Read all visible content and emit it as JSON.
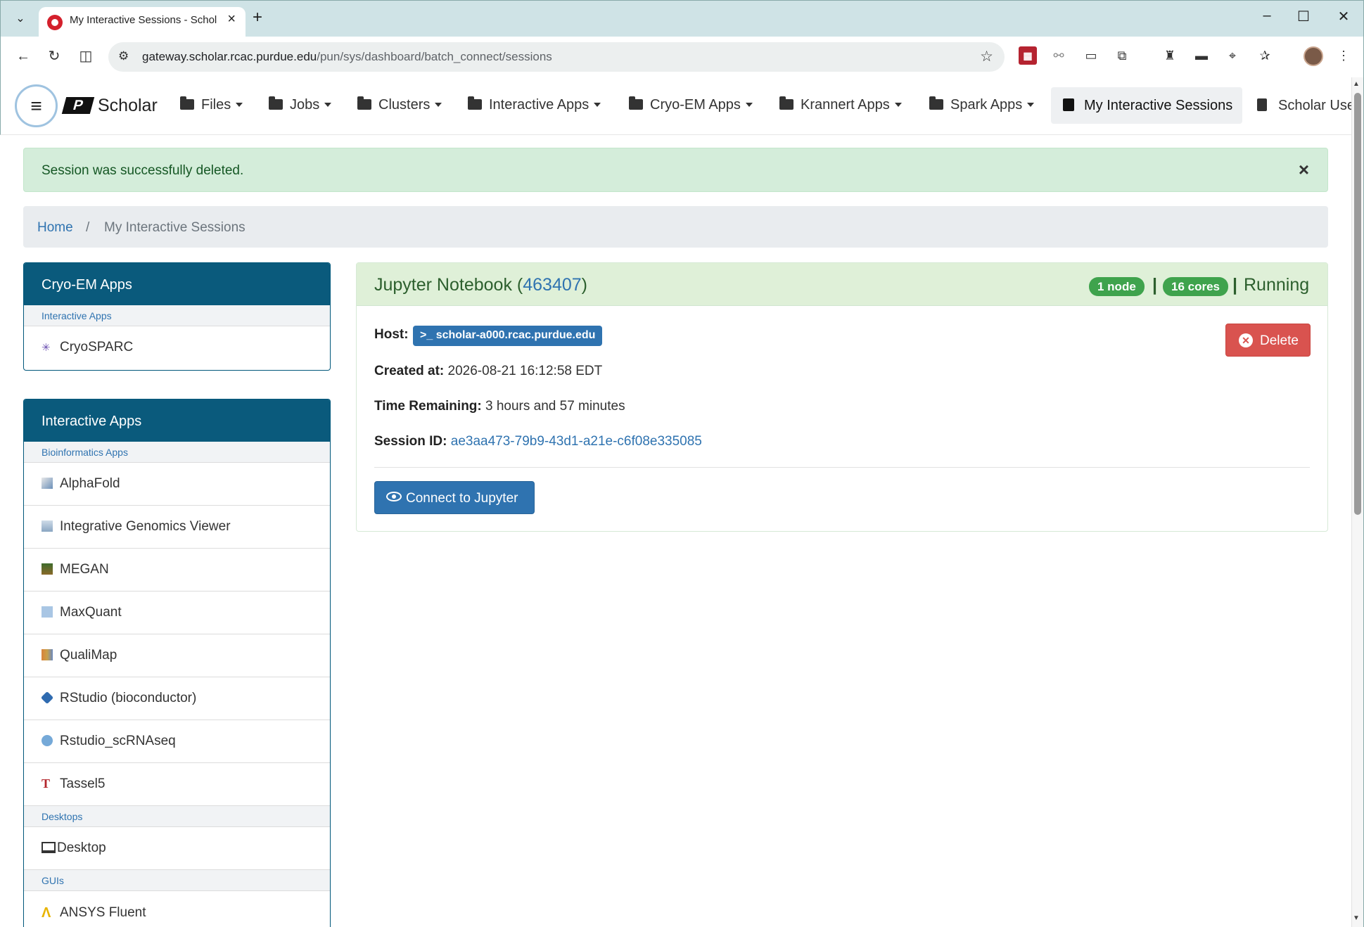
{
  "browser": {
    "tab_title": "My Interactive Sessions - Scholar",
    "url_host": "gateway.scholar.rcac.purdue.edu",
    "url_path": "/pun/sys/dashboard/batch_connect/sessions"
  },
  "navbar": {
    "brand": "Scholar",
    "items": [
      {
        "label": "Files"
      },
      {
        "label": "Jobs"
      },
      {
        "label": "Clusters"
      },
      {
        "label": "Interactive Apps"
      },
      {
        "label": "Cryo-EM Apps"
      },
      {
        "label": "Krannert Apps"
      },
      {
        "label": "Spark Apps"
      }
    ],
    "active": "My Interactive Sessions",
    "guide": "Scholar Use"
  },
  "alert": {
    "message": "Session was successfully deleted.",
    "close": "×"
  },
  "breadcrumb": {
    "home": "Home",
    "sep": "/",
    "current": "My Interactive Sessions"
  },
  "sidebar": {
    "cryo_panel": {
      "title": "Cryo-EM Apps",
      "section": "Interactive Apps",
      "items": [
        {
          "label": "CryoSPARC",
          "icon": "cryosparc-icon"
        }
      ]
    },
    "apps_panel": {
      "title": "Interactive Apps",
      "sections": [
        {
          "label": "Bioinformatics Apps"
        },
        {
          "label": "Desktops"
        },
        {
          "label": "GUIs"
        }
      ],
      "items": [
        {
          "label": "AlphaFold",
          "icon": "alphafold-icon"
        },
        {
          "label": "Integrative Genomics Viewer",
          "icon": "igv-icon"
        },
        {
          "label": "MEGAN",
          "icon": "megan-icon"
        },
        {
          "label": "MaxQuant",
          "icon": "maxquant-icon"
        },
        {
          "label": "QualiMap",
          "icon": "qualimap-icon"
        },
        {
          "label": "RStudio (bioconductor)",
          "icon": "rstudio-bioconductor-icon"
        },
        {
          "label": "Rstudio_scRNAseq",
          "icon": "rstudio-icon"
        },
        {
          "label": "Tassel5",
          "icon": "tassel-icon"
        },
        {
          "label": "Desktop",
          "icon": "monitor-icon"
        },
        {
          "label": "ANSYS Fluent",
          "icon": "ansys-icon"
        }
      ]
    }
  },
  "session": {
    "app_name": "Jupyter Notebook",
    "job_id": "463407",
    "open_paren": "(",
    "close_paren": ")",
    "nodes": "1 node",
    "cores": "16 cores",
    "pipe": "|",
    "status": "Running",
    "host_label": "Host:",
    "host": ">_ scholar-a000.rcac.purdue.edu",
    "created_label": "Created at:",
    "created": "2026-08-21 16:12:58 EDT",
    "remaining_label": "Time Remaining:",
    "remaining": "3 hours and 57 minutes",
    "session_id_label": "Session ID:",
    "session_id": "ae3aa473-79b9-43d1-a21e-c6f08e335085",
    "connect_label": "Connect to Jupyter",
    "delete_label": "Delete"
  },
  "colors": {
    "navy_panel": "#0a5a7c",
    "link": "#2f73b0",
    "success_badge": "#3fa34d",
    "danger": "#d9534f",
    "alert_bg": "#d4edda"
  }
}
